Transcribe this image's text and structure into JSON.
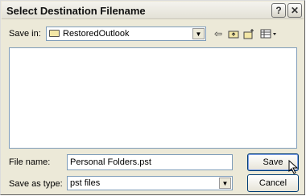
{
  "dialog": {
    "title": "Select Destination Filename",
    "help_glyph": "?",
    "close_glyph": "✕"
  },
  "toolbar": {
    "save_in_label": "Save in:",
    "save_in_value": "RestoredOutlook",
    "back_glyph": "⇦",
    "up_glyph": "⇧",
    "newfolder_glyph": "✱",
    "views_glyph": "▦▾"
  },
  "fields": {
    "file_name_label": "File name:",
    "file_name_value": "Personal Folders.pst",
    "save_as_type_label": "Save as type:",
    "save_as_type_value": "pst files"
  },
  "buttons": {
    "save_label": "Save",
    "cancel_label": "Cancel"
  },
  "icons": {
    "folder": "folder-icon",
    "back": "back-arrow-icon",
    "up": "up-folder-icon",
    "new_folder": "new-folder-icon",
    "views": "views-menu-icon",
    "cursor": "mouse-pointer-icon"
  }
}
